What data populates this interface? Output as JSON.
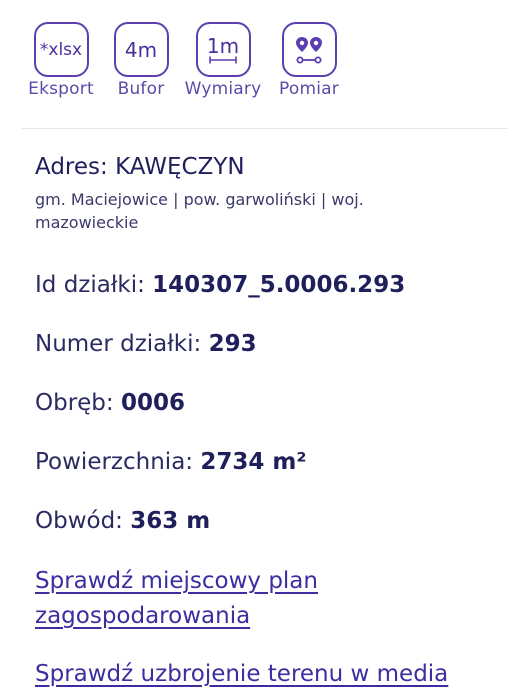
{
  "toolbar": {
    "export": {
      "icon_text": "*xlsx",
      "label": "Eksport"
    },
    "buffer": {
      "icon_text": "4m",
      "label": "Bufor"
    },
    "dimensions": {
      "icon_text": "1m",
      "label": "Wymiary"
    },
    "measure": {
      "label": "Pomiar"
    }
  },
  "address": {
    "prefix": "Adres:",
    "value": "KAWĘCZYN",
    "sub": "gm. Maciejowice | pow. garwoliński | woj. mazowieckie"
  },
  "details": {
    "id": {
      "label": "Id działki:",
      "value": "140307_5.0006.293"
    },
    "number": {
      "label": "Numer działki:",
      "value": "293"
    },
    "precinct": {
      "label": "Obręb:",
      "value": "0006"
    },
    "area": {
      "label": "Powierzchnia:",
      "value": "2734 m²"
    },
    "perimeter": {
      "label": "Obwód:",
      "value": "363 m"
    }
  },
  "links": {
    "zoning_plan": "Sprawdź miejscowy plan zagospodarowania",
    "utilities": "Sprawdź uzbrojenie terenu w media"
  },
  "colors": {
    "accent": "#5b3fb0",
    "text": "#1f1f5c"
  }
}
